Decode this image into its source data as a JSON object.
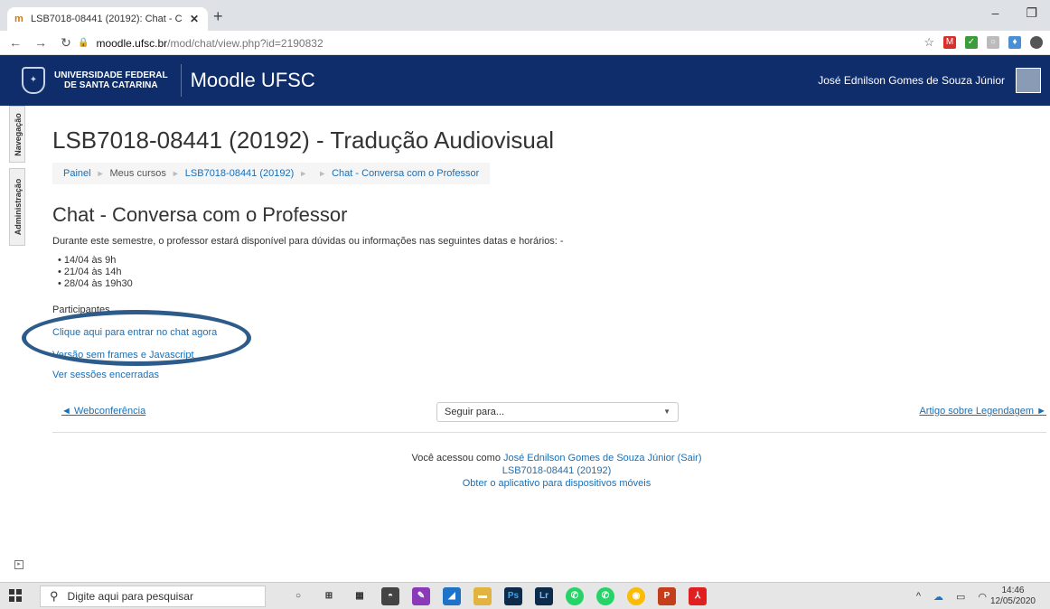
{
  "browser": {
    "tab_title": "LSB7018-08441 (20192): Chat - C",
    "tab_favicon": "m",
    "url_host": "moodle.ufsc.br",
    "url_path": "/mod/chat/view.php?id=2190832"
  },
  "header": {
    "university_line1": "UNIVERSIDADE FEDERAL",
    "university_line2": "DE SANTA CATARINA",
    "brand": "Moodle UFSC",
    "user_name": "José Ednilson Gomes de Souza Júnior"
  },
  "side_tabs": {
    "navigation": "Navegação",
    "administration": "Administração"
  },
  "page": {
    "course_title": "LSB7018-08441 (20192) - Tradução Audiovisual",
    "breadcrumb": [
      "Painel",
      "Meus cursos",
      "LSB7018-08441 (20192)",
      "Chat - Conversa com o Professor"
    ],
    "chat_title": "Chat - Conversa com o Professor",
    "intro": "Durante este semestre, o professor estará disponível para dúvidas ou informações nas seguintes datas e horários: -",
    "dates": [
      "14/04 às 9h",
      "21/04 às 14h",
      "28/04 às 19h30"
    ],
    "participants_label": "Participantes",
    "enter_chat": "Clique aqui para entrar no chat agora",
    "no_frames": "Versão sem frames e Javascript",
    "past_sessions": "Ver sessões encerradas",
    "prev_activity": "◄ Webconferência",
    "jump_to": "Seguir para...",
    "next_activity": "Artigo sobre Legendagem ►"
  },
  "footer": {
    "logged_as": "Você acessou como",
    "user_link": "José Ednilson Gomes de Souza Júnior",
    "logout": "(Sair)",
    "course_link": "LSB7018-08441 (20192)",
    "mobile_app": "Obter o aplicativo para dispositivos móveis"
  },
  "taskbar": {
    "search_placeholder": "Digite aqui para pesquisar",
    "time": "14:46",
    "date": "12/05/2020"
  },
  "colors": {
    "navbar": "#0f2d6b",
    "link": "#1a6fb5",
    "annotation_circle": "#2d5b8a"
  }
}
